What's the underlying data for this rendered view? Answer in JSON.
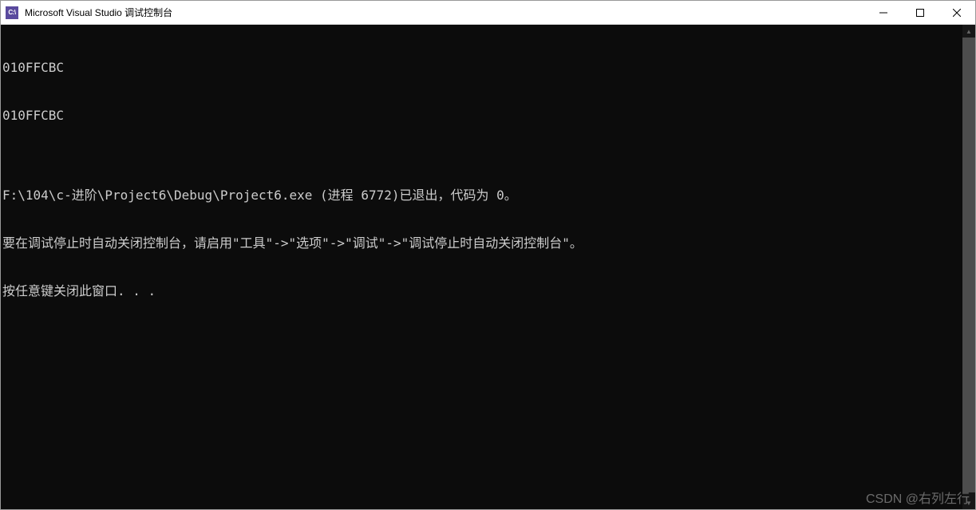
{
  "titlebar": {
    "icon_text": "C:\\",
    "title": "Microsoft Visual Studio 调试控制台"
  },
  "console": {
    "lines": [
      "010FFCBC",
      "010FFCBC",
      "",
      "F:\\104\\c-进阶\\Project6\\Debug\\Project6.exe (进程 6772)已退出，代码为 0。",
      "要在调试停止时自动关闭控制台，请启用\"工具\"->\"选项\"->\"调试\"->\"调试停止时自动关闭控制台\"。",
      "按任意键关闭此窗口. . ."
    ]
  },
  "watermark": "CSDN @右列左行"
}
